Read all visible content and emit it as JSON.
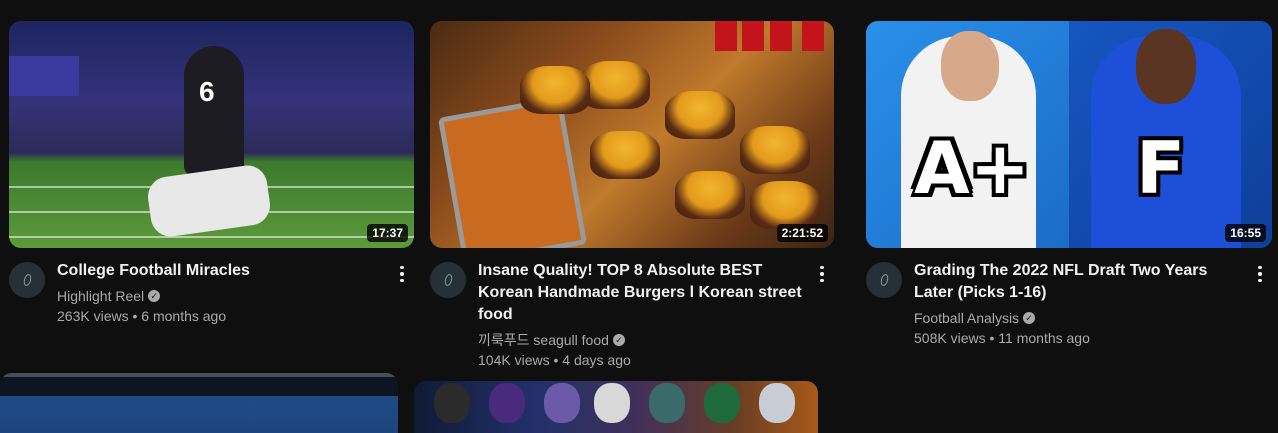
{
  "videos": [
    {
      "title": "College Football Miracles",
      "channel": "Highlight Reel",
      "views": "263K views",
      "age": "6 months ago",
      "duration": "17:37",
      "verified": true
    },
    {
      "title": "Insane Quality! TOP 8 Absolute BEST Korean Handmade Burgers l Korean street food",
      "channel": "끼룩푸드 seagull food",
      "views": "104K views",
      "age": "4 days ago",
      "duration": "2:21:52",
      "verified": true
    },
    {
      "title": "Grading The 2022 NFL Draft Two Years Later (Picks 1-16)",
      "channel": "Football Analysis",
      "views": "508K views",
      "age": "11 months ago",
      "duration": "16:55",
      "verified": true,
      "thumb_text": [
        "A+",
        "F"
      ]
    }
  ],
  "separator": "•",
  "verified_glyph": "✓",
  "icons": {
    "menu": "more-vert-icon",
    "verified": "verified-badge-icon"
  },
  "colors": {
    "background": "#0f0f0f",
    "primary_text": "#f1f1f1",
    "secondary_text": "#aaaaaa"
  }
}
